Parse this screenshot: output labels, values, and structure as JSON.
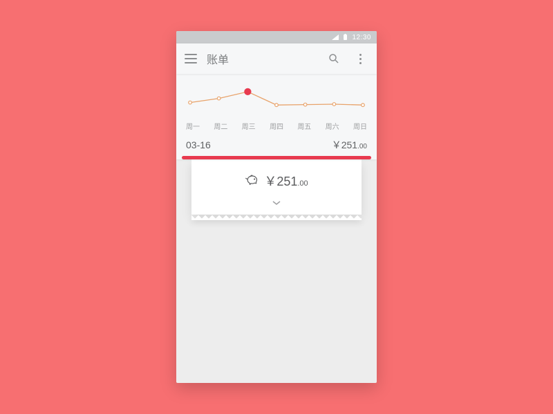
{
  "statusbar": {
    "time": "12:30"
  },
  "appbar": {
    "title": "账单"
  },
  "chart_data": {
    "type": "line",
    "categories": [
      "周一",
      "周二",
      "周三",
      "周四",
      "周五",
      "周六",
      "周日"
    ],
    "values": [
      120,
      170,
      251,
      90,
      95,
      100,
      90
    ],
    "selected_index": 2,
    "ylim": [
      0,
      300
    ]
  },
  "summary": {
    "date": "03-16",
    "currency": "￥",
    "amount_int": "251",
    "amount_cents": ".00"
  },
  "receipt": {
    "currency": "￥",
    "amount_int": "251",
    "amount_cents": ".00"
  },
  "colors": {
    "accent": "#E83A4F",
    "line": "#E8A36B"
  }
}
